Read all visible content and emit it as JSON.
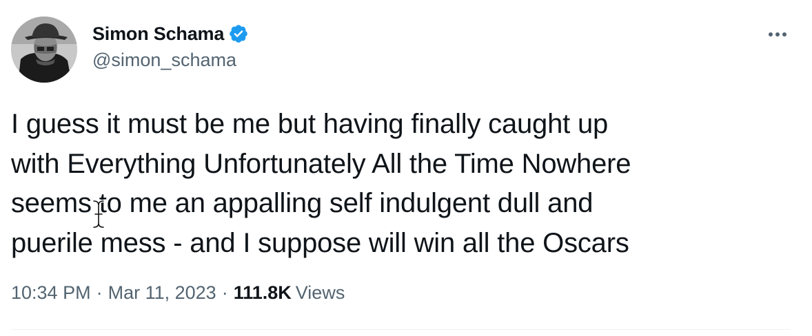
{
  "author": {
    "display_name": "Simon Schama",
    "handle": "@simon_schama",
    "verified_icon": "verified-badge-icon",
    "verified_color": "#1d9bf0"
  },
  "tweet": {
    "lines": [
      "I guess it must be me but having finally caught up",
      "with Everything Unfortunately All the Time Nowhere",
      "seems to me an appalling self indulgent dull and",
      "puerile mess - and I suppose will win all the Oscars"
    ]
  },
  "meta": {
    "time": "10:34 PM",
    "separator": "·",
    "date": "Mar 11, 2023",
    "views_count": "111.8K",
    "views_label": "Views"
  },
  "menu": {
    "more_icon": "more-options-icon"
  },
  "colors": {
    "text_primary": "#0f1419",
    "text_secondary": "#536471",
    "divider": "#eff3f4"
  }
}
